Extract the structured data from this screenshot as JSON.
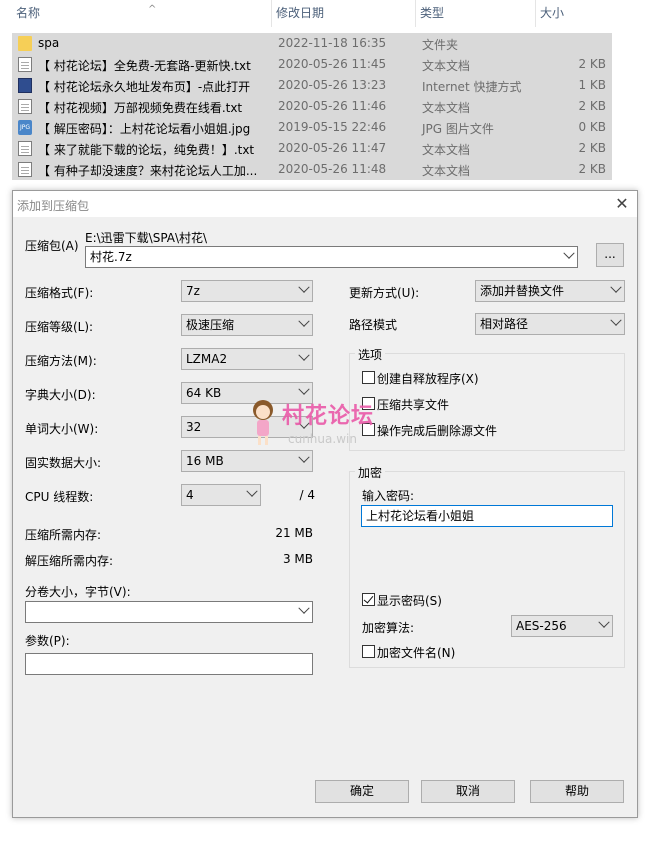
{
  "explorer": {
    "columns": [
      "名称",
      "修改日期",
      "类型",
      "大小"
    ],
    "sort_arrow": "^",
    "rows": [
      {
        "name": "spa",
        "date": "2022-11-18 16:35",
        "type": "文件夹",
        "size": "",
        "icon": "folder-icon"
      },
      {
        "name": "【 村花论坛】全免费-无套路-更新快.txt",
        "date": "2020-05-26 11:45",
        "type": "文本文档",
        "size": "2 KB",
        "icon": "text-file-icon"
      },
      {
        "name": "【 村花论坛永久地址发布页】-点此打开",
        "date": "2020-05-26 13:23",
        "type": "Internet 快捷方式",
        "size": "1 KB",
        "icon": "shortcut-icon"
      },
      {
        "name": "【 村花视频】万部视频免费在线看.txt",
        "date": "2020-05-26 11:46",
        "type": "文本文档",
        "size": "2 KB",
        "icon": "text-file-icon"
      },
      {
        "name": "【 解压密码】：上村花论坛看小姐姐.jpg",
        "date": "2019-05-15 22:46",
        "type": "JPG 图片文件",
        "size": "0 KB",
        "icon": "jpg-file-icon"
      },
      {
        "name": "【 来了就能下载的论坛，纯免费！】.txt",
        "date": "2020-05-26 11:47",
        "type": "文本文档",
        "size": "2 KB",
        "icon": "text-file-icon"
      },
      {
        "name": "【 有种子却没速度？来村花论坛人工加...",
        "date": "2020-05-26 11:48",
        "type": "文本文档",
        "size": "2 KB",
        "icon": "text-file-icon"
      }
    ]
  },
  "dialog": {
    "title": "添加到压缩包",
    "close": "✕",
    "archive_label": "压缩包(A)",
    "archive_path": "E:\\迅雷下载\\SPA\\村花\\",
    "archive_name": "村花.7z",
    "browse": "...",
    "format_label": "压缩格式(F):",
    "format_value": "7z",
    "level_label": "压缩等级(L):",
    "level_value": "极速压缩",
    "method_label": "压缩方法(M):",
    "method_value": "LZMA2",
    "dict_label": "字典大小(D):",
    "dict_value": "64 KB",
    "word_label": "单词大小(W):",
    "word_value": "32",
    "solid_label": "固实数据大小:",
    "solid_value": "16 MB",
    "cpu_label": "CPU 线程数:",
    "cpu_value": "4",
    "cpu_total": "/ 4",
    "mem_comp_label": "压缩所需内存:",
    "mem_comp_value": "21 MB",
    "mem_decomp_label": "解压缩所需内存:",
    "mem_decomp_value": "3 MB",
    "split_label": "分卷大小，字节(V):",
    "split_value": "",
    "params_label": "参数(P):",
    "params_value": "",
    "update_label": "更新方式(U):",
    "update_value": "添加并替换文件",
    "path_label": "路径模式",
    "path_value": "相对路径",
    "options_title": "选项",
    "opt_sfx": "创建自释放程序(X)",
    "opt_shared": "压缩共享文件",
    "opt_delete": "操作完成后删除源文件",
    "enc_title": "加密",
    "enc_pwd_label": "输入密码:",
    "enc_pwd_value": "上村花论坛看小姐姐",
    "enc_show": "显示密码(S)",
    "enc_method_label": "加密算法:",
    "enc_method_value": "AES-256",
    "enc_names": "加密文件名(N)",
    "ok": "确定",
    "cancel": "取消",
    "help": "帮助"
  },
  "watermark": {
    "text": "村花论坛",
    "sub": "cunhua.win"
  }
}
